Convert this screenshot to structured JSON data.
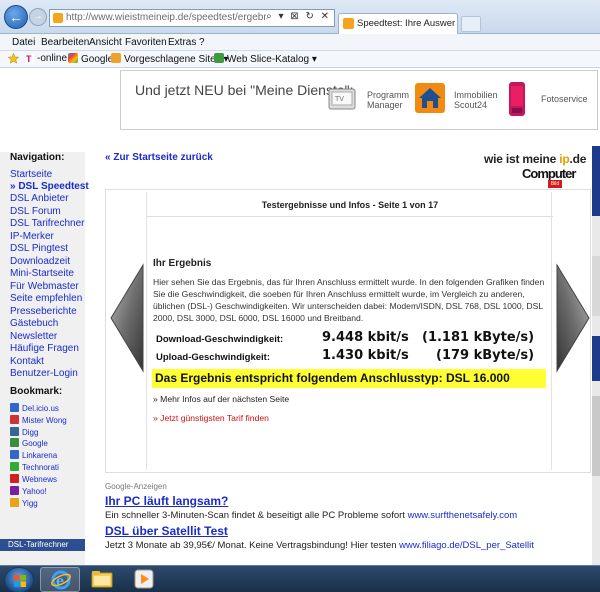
{
  "browser": {
    "address": "http://www.wieistmeineip.de/speedtest/ergebnis.php#470144",
    "address_buttons": "⌕ ▾ ⊠ ↻ ✕",
    "tab_title": "Speedtest: Ihre Auswertung ...",
    "menu": [
      "Datei",
      "Bearbeiten",
      "Ansicht",
      "Favoriten",
      "Extras",
      "?"
    ],
    "favorites": [
      "-online",
      "Google",
      "Vorgeschlagene Sites ▾",
      "Web Slice-Katalog ▾"
    ]
  },
  "banner": {
    "title": "Und jetzt NEU bei \"Meine Dienste\":",
    "items": [
      {
        "label1": "Programm",
        "label2": "Manager",
        "icon": "tv-icon"
      },
      {
        "label1": "Immobilien",
        "label2": "Scout24",
        "icon": "house-icon"
      },
      {
        "label1": "Fotoservice",
        "label2": "",
        "icon": "film-icon"
      }
    ]
  },
  "sidebar": {
    "nav_heading": "Navigation:",
    "nav_items": [
      "Startseite",
      "» DSL Speedtest",
      "DSL Anbieter",
      "DSL Forum",
      "DSL Tarifrechner",
      "IP-Merker",
      "DSL Pingtest",
      "Downloadzeit",
      "Mini-Startseite",
      "Für Webmaster",
      "Seite empfehlen",
      "Presseberichte",
      "Gästebuch",
      "Newsletter",
      "Häufige Fragen",
      "Kontakt",
      "Benutzer-Login"
    ],
    "bookmark_heading": "Bookmark:",
    "bookmarks": [
      {
        "label": "Del.icio.us",
        "color": "#3366cc"
      },
      {
        "label": "Mister Wong",
        "color": "#cc3333"
      },
      {
        "label": "Digg",
        "color": "#336699"
      },
      {
        "label": "Google",
        "color": "#3b8e3b"
      },
      {
        "label": "Linkarena",
        "color": "#3366cc"
      },
      {
        "label": "Technorati",
        "color": "#33aa33"
      },
      {
        "label": "Webnews",
        "color": "#cc2222"
      },
      {
        "label": "Yahoo!",
        "color": "#7b1fa2"
      },
      {
        "label": "Yigg",
        "color": "#e8a317"
      }
    ],
    "footer": "DSL-Tarifrechner"
  },
  "main": {
    "back_link": "« Zur Startseite zurück",
    "logo_line1_a": "wie ist meine ",
    "logo_line1_ip": "ip",
    "logo_line1_b": ".de",
    "logo_line2": "Computer",
    "logo_badge": "Bild",
    "panel_title": "Testergebnisse und Infos - Seite 1 von 17",
    "result_heading": "Ihr Ergebnis",
    "result_desc": "Hier sehen Sie das Ergebnis, das für Ihren Anschluss ermittelt wurde. In den folgenden Grafiken finden Sie die Geschwindigkeit, die soeben für Ihren Anschluss ermittelt wurde, im Vergleich zu anderen, üblichen (DSL-) Geschwindigkeiten. Wir unterscheiden dabei: Modem/ISDN, DSL 768, DSL 1000, DSL 2000, DSL 3000, DSL 6000, DSL 16000 und Breitband.",
    "download_label": "Download-Geschwindigkeit:",
    "download_kbit": "9.448 kbit/s",
    "download_kbyte": "(1.181 kByte/s)",
    "upload_label": "Upload-Geschwindigkeit:",
    "upload_kbit": "1.430 kbit/s",
    "upload_kbyte": "(179 kByte/s)",
    "result_line": "Das Ergebnis entspricht folgendem Anschlusstyp: DSL 16.000",
    "more_link": "» Mehr Infos auf der nächsten Seite",
    "tarif_link": "» Jetzt günstigsten Tarif finden"
  },
  "ads": {
    "label": "Google-Anzeigen",
    "items": [
      {
        "title": "Ihr PC läuft langsam?",
        "text": "Ein schneller 3-Minuten-Scan findet & beseitigt alle PC Probleme sofort ",
        "url": "www.surfthenetsafely.com"
      },
      {
        "title": "DSL über Satellit Test",
        "text": "Jetzt 3 Monate ab 39,95€/ Monat. Keine Vertragsbindung! Hier testen ",
        "url": "www.filiago.de/DSL_per_Satellit"
      }
    ]
  },
  "colors": {
    "link": "#1a2bcc",
    "highlight": "#ffff33",
    "tarif": "#cc1111"
  }
}
